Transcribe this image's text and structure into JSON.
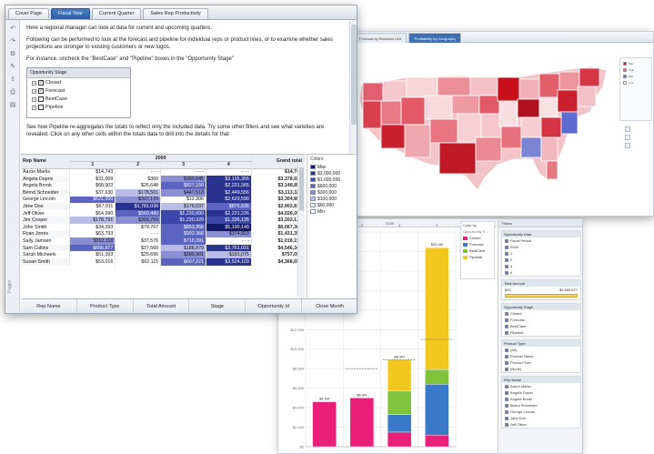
{
  "main": {
    "tabs": [
      {
        "label": "Cover Page",
        "active": false
      },
      {
        "label": "Fiscal Year",
        "active": true
      },
      {
        "label": "Current Quarter",
        "active": false
      },
      {
        "label": "Sales Rep Productivity",
        "active": false
      }
    ],
    "side_label": "Pages",
    "paragraphs": [
      "Here a regional manager can look at data for current and upcoming quarters.",
      "Following can be performed to look at the forecast and pipeline for individual reps or product lines, or to examine whether sales projections are stronger to existing customers or new logos.",
      "For instance, uncheck the \"BestCase\" and \"Pipeline\" boxes in the \"Opportunity Stage\""
    ],
    "paragraph_after": "See how Pipeline re-aggregates the totals to reflect only the included data. Try some other filters and see what varieties are revealed. Click on any other cells within the totals data to drill into the details for that",
    "stage_box": {
      "title": "Opportunity Stage",
      "items": [
        {
          "label": "Closed",
          "checked": true
        },
        {
          "label": "Forecast",
          "checked": true
        },
        {
          "label": "BestCase",
          "checked": false
        },
        {
          "label": "Pipeline",
          "checked": false
        }
      ]
    }
  },
  "crosstab": {
    "corner": "Rep Name",
    "year": "2009",
    "quarters": [
      "1",
      "2",
      "3",
      "4"
    ],
    "total_header": "Grand total",
    "rows": [
      {
        "name": "Aaron Marks",
        "q": [
          "$14,743",
          "- - -",
          "- - -",
          "- - -"
        ],
        "shade": [
          1,
          0,
          0,
          0
        ],
        "total": "$14,743"
      },
      {
        "name": "Angela Duprix",
        "q": [
          "$31,009",
          "$360",
          "$380,845",
          "$3,135,355"
        ],
        "shade": [
          1,
          1,
          3,
          6
        ],
        "total": "$3,378,658"
      },
      {
        "name": "Angela Borok",
        "q": [
          "$68,903",
          "$26,648",
          "$827,150",
          "$2,231,365"
        ],
        "shade": [
          1,
          1,
          4,
          6
        ],
        "total": "$3,148,856"
      },
      {
        "name": "Bernd Schneider",
        "q": [
          "$37,630",
          "$178,501",
          "$447,513",
          "$2,449,556"
        ],
        "shade": [
          1,
          2,
          3,
          6
        ],
        "total": "$3,113,320"
      },
      {
        "name": "George Lincoln",
        "q": [
          "$621,000",
          "$327,170",
          "$12,306",
          "$2,629,590"
        ],
        "shade": [
          4,
          3,
          1,
          6
        ],
        "total": "$3,304,857"
      },
      {
        "name": "Jane Doe",
        "q": [
          "$67,911",
          "$1,781,036",
          "$176,037",
          "$875,826"
        ],
        "shade": [
          1,
          6,
          2,
          4
        ],
        "total": "$2,902,810"
      },
      {
        "name": "Jeff Oliver",
        "q": [
          "$64,090",
          "$560,480",
          "$1,230,899",
          "$2,221,226"
        ],
        "shade": [
          1,
          4,
          5,
          6
        ],
        "total": "$4,026,095"
      },
      {
        "name": "Jim Cooper",
        "q": [
          "$178,791",
          "$350,760",
          "$1,230,329",
          "$1,336,135"
        ],
        "shade": [
          2,
          3,
          5,
          5
        ],
        "total": "$3,202,131"
      },
      {
        "name": "John Smith",
        "q": [
          "$34,393",
          "$79,767",
          "$853,356",
          "$5,100,149"
        ],
        "shade": [
          1,
          1,
          4,
          7
        ],
        "total": "$6,067,366"
      },
      {
        "name": "Ryan Jones",
        "q": [
          "$63,793",
          "- - -",
          "$992,366",
          "$374,923"
        ],
        "shade": [
          1,
          0,
          4,
          3
        ],
        "total": "$1,431,358"
      },
      {
        "name": "Sally Jamsen",
        "q": [
          "$262,118",
          "$37,576",
          "$718,391",
          "- - -"
        ],
        "shade": [
          3,
          1,
          4,
          0
        ],
        "total": "$1,018,199"
      },
      {
        "name": "Sam Collins",
        "q": [
          "$656,877",
          "$37,560",
          "$188,879",
          "$3,761,031"
        ],
        "shade": [
          4,
          1,
          2,
          6
        ],
        "total": "$4,546,348"
      },
      {
        "name": "Sarah Michaels",
        "q": [
          "$51,393",
          "$25,696",
          "$390,901",
          "$191,075"
        ],
        "shade": [
          1,
          1,
          3,
          2
        ],
        "total": "$757,093"
      },
      {
        "name": "Susan Smith",
        "q": [
          "$53,016",
          "$62,115",
          "$607,221",
          "$3,524,103"
        ],
        "shade": [
          1,
          1,
          4,
          6
        ],
        "total": "$4,368,659"
      }
    ]
  },
  "colors_panel": {
    "title": "Colors",
    "items": [
      {
        "label": "Max",
        "color": "#141a6b"
      },
      {
        "label": "$3,000,000",
        "color": "#2a3290"
      },
      {
        "label": "$1,000,000",
        "color": "#3c47aa"
      },
      {
        "label": "$600,000",
        "color": "#5c64c0"
      },
      {
        "label": "$300,000",
        "color": "#8a8fd4"
      },
      {
        "label": "$100,000",
        "color": "#b9bce6"
      },
      {
        "label": "$60,000",
        "color": "#ffffff"
      },
      {
        "label": "Min",
        "color": "#ffffff"
      }
    ]
  },
  "column_bar": {
    "items": [
      "Rep Name",
      "Product Type",
      "Total Amount",
      "Stage",
      "Opportunity Id",
      "Close Month"
    ]
  },
  "shade_colors": [
    "#ffffff",
    "#ffffff",
    "#b9bce6",
    "#8a8fd4",
    "#5c64c0",
    "#3c47aa",
    "#2a3290",
    "#141a6b"
  ],
  "map": {
    "tabs": [
      "Forecast by Business Unit",
      "Profitability by Geography"
    ],
    "legend_items": [
      "Max",
      "High",
      "Mid",
      "Low"
    ],
    "legend_colors": [
      "#c0101a",
      "#e06070",
      "#5a6fd0",
      "#ffffff"
    ]
  },
  "bar_panel": {
    "header": "2009",
    "color_by_title": "Color by",
    "color_by_sub": "Opportunity S...",
    "legend": [
      {
        "label": "Closed",
        "color": "#e8207a"
      },
      {
        "label": "Forecast",
        "color": "#3a78c8"
      },
      {
        "label": "BestCase",
        "color": "#7fc23c"
      },
      {
        "label": "Pipeline",
        "color": "#f2c81e"
      }
    ],
    "y_ticks": [
      "$22,000",
      "$20,000",
      "$18,000",
      "$16,000",
      "$14,000",
      "$12,000",
      "$10,000",
      "$8,000",
      "$6,000",
      "$4,000",
      "$2,000",
      "$0"
    ],
    "bar_labels": [
      "$4.6M",
      "$5.0M",
      "$8.9M",
      "$20.4M"
    ]
  },
  "chart_data": {
    "type": "bar",
    "categories": [
      "1",
      "2",
      "3",
      "4"
    ],
    "stacked": true,
    "series": [
      {
        "name": "Closed",
        "values": [
          4.6,
          5.0,
          1.5,
          1.2
        ]
      },
      {
        "name": "Forecast",
        "values": [
          0,
          0,
          1.8,
          5.2
        ]
      },
      {
        "name": "BestCase",
        "values": [
          0,
          0,
          2.4,
          1.5
        ]
      },
      {
        "name": "Pipeline",
        "values": [
          0,
          0,
          3.2,
          12.5
        ]
      }
    ],
    "ylabel": "",
    "ylim": [
      0,
      22
    ]
  },
  "filters": {
    "title": "Filters",
    "sections": [
      {
        "title": "Opportunity Data",
        "rows": [
          "Fiscal Period",
          "2009",
          "1",
          "2",
          "3",
          "4"
        ]
      },
      {
        "title": "Total Amount",
        "rows": [
          "$20",
          "$5,669,677"
        ]
      },
      {
        "title": "Opportunity Stage",
        "rows": [
          "Closed",
          "Forecast",
          "BestCase",
          "Pipeline"
        ]
      },
      {
        "title": "Product Type",
        "rows": [
          "(All)",
          "Product Name",
          "Product Size",
          "(None)"
        ]
      },
      {
        "title": "Rep Name",
        "rows": [
          "Aaron Marks",
          "Angela Duprix",
          "Angela Borok",
          "Bernd Schneider",
          "George Lincoln",
          "Jane Doe",
          "Jeff Oliver"
        ]
      }
    ]
  }
}
